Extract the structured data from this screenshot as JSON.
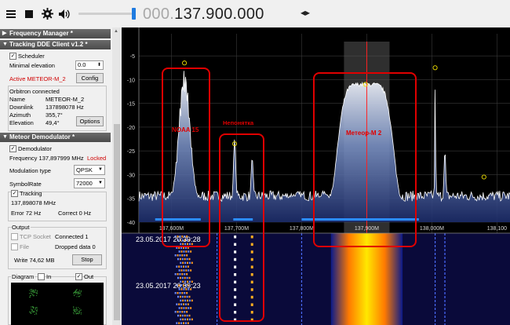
{
  "toolbar": {
    "menu_icon": "hamburger-icon",
    "stop_icon": "stop-icon",
    "settings_icon": "gear-icon",
    "volume_icon": "speaker-icon",
    "frequency_dim": "000.",
    "frequency_main": "137.900.000",
    "tuning_arrows": "◂▸",
    "volume_level": 1.0
  },
  "panel": {
    "frequency_manager": {
      "title": "Frequency Manager *"
    },
    "tracking": {
      "title": "Tracking DDE Client v1.2 *",
      "scheduler_label": "Scheduler",
      "min_elevation_label": "Minimal elevation",
      "min_elevation_value": "0.0",
      "active_satellite": "Active METEOR-M_2",
      "config_button": "Config",
      "orbitron_status": "Orbitron connected",
      "rows": [
        {
          "label": "Name",
          "value": "METEOR-M_2"
        },
        {
          "label": "Downlink",
          "value": "137898078 Hz"
        },
        {
          "label": "Azimuth",
          "value": "355,7°"
        },
        {
          "label": "Elevation",
          "value": "49,4°"
        }
      ],
      "options_button": "Options"
    },
    "demodulator": {
      "title": "Meteor Demodulator *",
      "demodulator_label": "Demodulator",
      "frequency_text": "Frequency 137,897999 MHz",
      "locked_text": "Locked",
      "modulation_label": "Modulation type",
      "modulation_value": "QPSK",
      "symbolrate_label": "SymbolRate",
      "symbolrate_value": "72000",
      "tracking_label": "Tracking",
      "tracking_freq": "137,898078 MHz",
      "error_text": "Error 72 Hz",
      "correct_text": "Correct 0 Hz",
      "output_label": "Output",
      "tcp_label": "TCP Socket",
      "tcp_status": "Connected 1",
      "file_label": "File",
      "dropped_text": "Dropped data 0",
      "write_text": "Write 74,62 MB",
      "stop_button": "Stop",
      "diagram_label": "Diagram",
      "in_label": "In",
      "out_label": "Out"
    }
  },
  "chart_data": {
    "type": "line",
    "xlabel": "",
    "ylabel": "",
    "x_ticks": [
      "137,600M",
      "137,700M",
      "137,800M",
      "137,900M",
      "138,000M",
      "138,100"
    ],
    "y_ticks": [
      "-5",
      "-10",
      "-15",
      "-20",
      "-25",
      "-30",
      "-35",
      "-40"
    ],
    "ylim": [
      -40,
      -2
    ],
    "xlim_mhz": [
      137.55,
      138.12
    ],
    "tuned_frequency_mhz": 137.9,
    "filter_band_mhz": [
      137.865,
      137.935
    ],
    "annotations": [
      {
        "label": "NOAA 15",
        "center_mhz": 137.62
      },
      {
        "label": "Непонятка",
        "center_mhz": 137.71
      },
      {
        "label": "Метеор-М 2",
        "center_mhz": 137.9
      }
    ],
    "waterfall_timestamps": [
      "23.05.2017 20:39:28",
      "23.05.2017 20:39:23"
    ]
  }
}
